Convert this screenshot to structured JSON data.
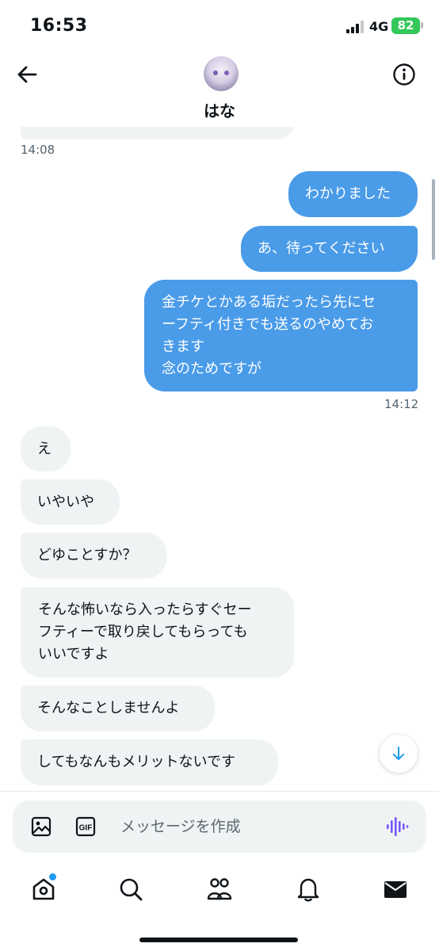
{
  "status_bar": {
    "time": "16:53",
    "network": "4G",
    "battery": "82"
  },
  "header": {
    "contact_name": "はな",
    "back_icon": "arrow-left-icon",
    "info_icon": "info-circle-icon"
  },
  "messages": [
    {
      "id": "m1",
      "direction": "sent",
      "text": "わかりました"
    },
    {
      "id": "m2",
      "direction": "sent",
      "text": "あ、待ってください"
    },
    {
      "id": "m3",
      "direction": "sent",
      "lines": [
        "金チケとかある垢だったら先にセ",
        "ーフティ付きでも送るのやめてお",
        "きます",
        "念のためですが"
      ]
    },
    {
      "id": "m4",
      "direction": "received",
      "text": "え"
    },
    {
      "id": "m5",
      "direction": "received",
      "text": "いやいや"
    },
    {
      "id": "m6",
      "direction": "received",
      "text": "どゆことすか？"
    },
    {
      "id": "m7",
      "direction": "received",
      "lines": [
        "そんな怖いなら入ったらすぐセー",
        "フティーで取り戻してもらっても",
        "いいですよ"
      ]
    },
    {
      "id": "m8",
      "direction": "received",
      "text": "そんなことしませんよ"
    },
    {
      "id": "m9",
      "direction": "received",
      "text": "してもなんもメリットないです"
    }
  ],
  "timestamps": {
    "received_prev": "14:08",
    "sent_group": "14:12"
  },
  "composer": {
    "placeholder": "メッセージを作成",
    "image_icon": "image-icon",
    "gif_label": "GIF",
    "voice_icon": "voice-wave-icon"
  },
  "tabbar": {
    "items": [
      "home",
      "search",
      "communities",
      "notifications",
      "messages"
    ],
    "active": "messages",
    "home_has_badge": true
  },
  "colors": {
    "sent_bubble": "#4a9be8",
    "received_bubble": "#eff3f4",
    "accent": "#1d9bf0",
    "voice_icon": "#7856ff",
    "battery": "#34c759"
  }
}
